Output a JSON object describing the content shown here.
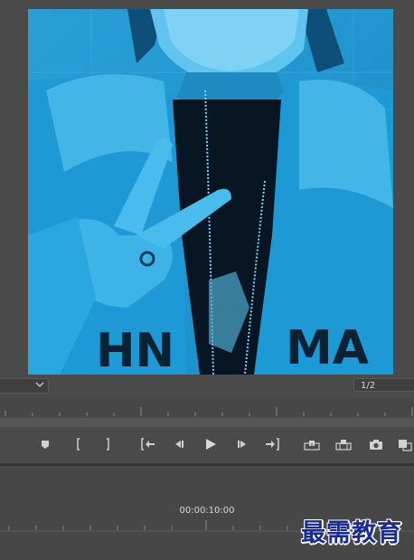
{
  "program_monitor": {
    "preview_image": "masked person in blue-tinted hoodie making peace sign",
    "fit_dropdown": {
      "value": "",
      "icon": "chevron-down-icon"
    },
    "resolution_dropdown": {
      "value": "1/2"
    }
  },
  "transport": {
    "buttons": [
      {
        "name": "add-marker-button",
        "icon": "marker-icon"
      },
      {
        "name": "mark-in-button",
        "icon": "mark-in-icon"
      },
      {
        "name": "mark-out-button",
        "icon": "mark-out-icon"
      },
      {
        "name": "go-to-in-button",
        "icon": "go-to-in-icon"
      },
      {
        "name": "step-back-button",
        "icon": "step-back-icon"
      },
      {
        "name": "play-button",
        "icon": "play-icon"
      },
      {
        "name": "step-forward-button",
        "icon": "step-forward-icon"
      },
      {
        "name": "go-to-out-button",
        "icon": "go-to-out-icon"
      },
      {
        "name": "lift-button",
        "icon": "lift-icon"
      },
      {
        "name": "extract-button",
        "icon": "extract-icon"
      },
      {
        "name": "export-frame-button",
        "icon": "camera-icon"
      },
      {
        "name": "compare-view-button",
        "icon": "compare-icon"
      }
    ]
  },
  "timeline": {
    "timecode": "00:00:10:00"
  },
  "watermark": {
    "text": "最需教育"
  },
  "colors": {
    "panel_bg": "#4a4a4a",
    "image_tint": "#1aa3dc",
    "watermark": "#1b2d8f"
  }
}
